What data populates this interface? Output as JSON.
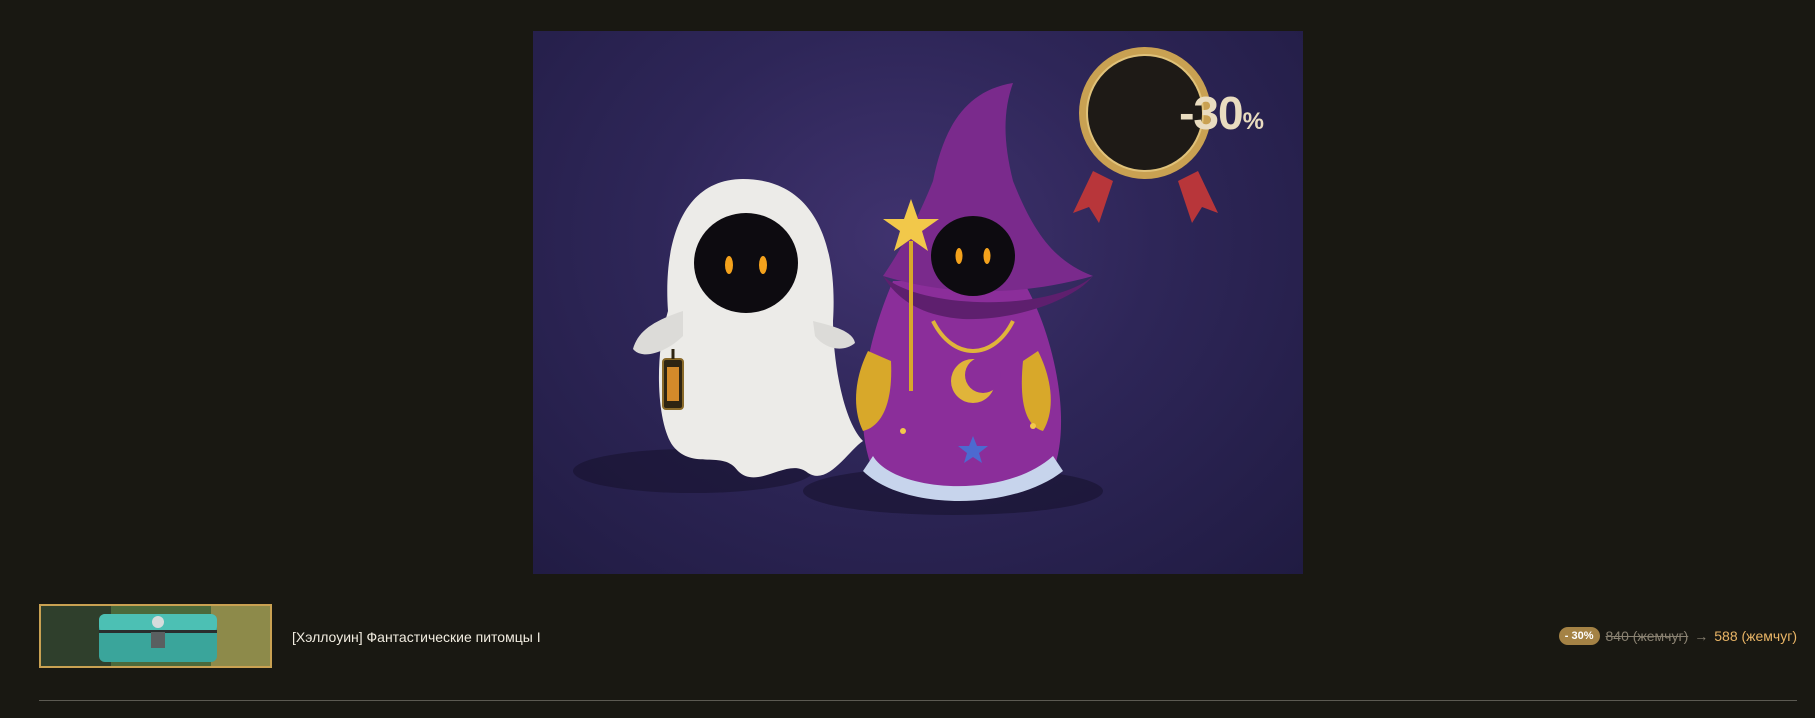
{
  "banner": {
    "discount_value": "-30",
    "discount_percent_sign": "%",
    "colors": {
      "background": "#2e2658",
      "badge_gold": "#c9a152",
      "ribbon": "#b8363a"
    }
  },
  "item": {
    "title": "[Хэллоуин] Фантастические питомцы I",
    "thumbnail": "chest-thumbnail",
    "discount_badge": "- 30%",
    "old_price": "840 (жемчуг)",
    "arrow": "→",
    "new_price": "588 (жемчуг)"
  },
  "colors": {
    "page_background": "#191812",
    "price_accent": "#e9b566",
    "thumbnail_border": "#c9a152"
  }
}
